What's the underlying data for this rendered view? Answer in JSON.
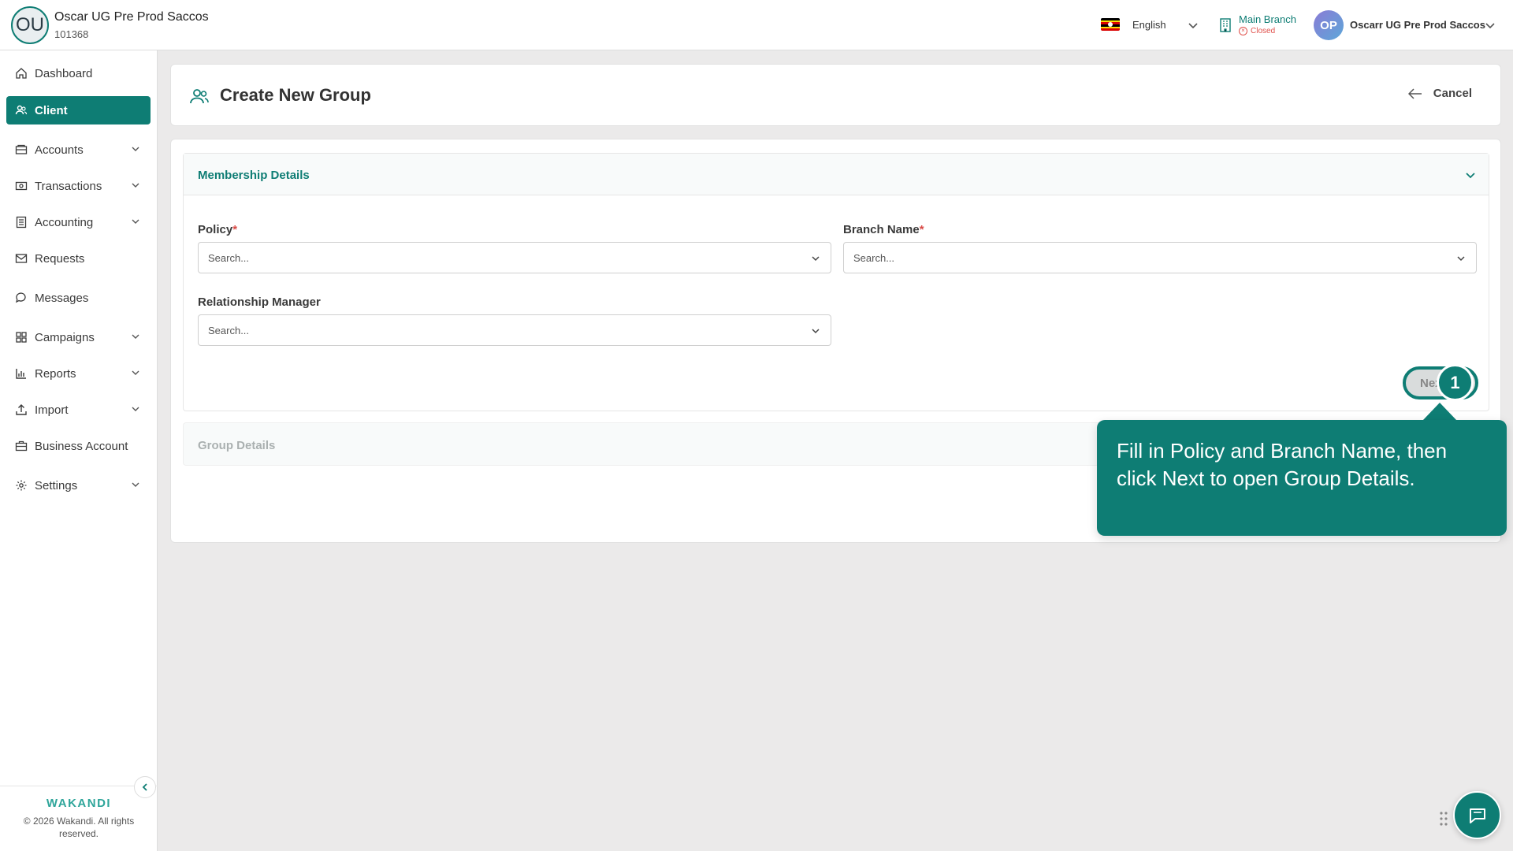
{
  "org": {
    "initials": "OU",
    "name": "Oscar UG Pre Prod Saccos",
    "id": "101368"
  },
  "header": {
    "language": "English",
    "branch_name": "Main Branch",
    "branch_status": "Closed",
    "user_initials": "OP",
    "user_name": "Oscarr UG Pre Prod Saccos"
  },
  "sidebar": {
    "items": [
      {
        "label": "Dashboard",
        "icon": "home-icon",
        "has_submenu": false
      },
      {
        "label": "Client",
        "icon": "users-icon",
        "has_submenu": false,
        "active": true
      },
      {
        "label": "Accounts",
        "icon": "wallet-icon",
        "has_submenu": true
      },
      {
        "label": "Transactions",
        "icon": "money-icon",
        "has_submenu": true
      },
      {
        "label": "Accounting",
        "icon": "ledger-icon",
        "has_submenu": true
      },
      {
        "label": "Requests",
        "icon": "mail-icon",
        "has_submenu": false
      },
      {
        "label": "Messages",
        "icon": "chat-icon",
        "has_submenu": false
      },
      {
        "label": "Campaigns",
        "icon": "grid-icon",
        "has_submenu": true
      },
      {
        "label": "Reports",
        "icon": "bar-chart-icon",
        "has_submenu": true
      },
      {
        "label": "Import",
        "icon": "upload-icon",
        "has_submenu": true
      },
      {
        "label": "Business Account",
        "icon": "briefcase-icon",
        "has_submenu": false
      },
      {
        "label": "Settings",
        "icon": "gear-icon",
        "has_submenu": true
      }
    ],
    "brand": "WAKANDI",
    "copyright": "© 2026 Wakandi. All rights reserved."
  },
  "page": {
    "title": "Create New Group",
    "cancel_label": "Cancel"
  },
  "form": {
    "section1_title": "Membership Details",
    "policy_label": "Policy",
    "policy_placeholder": "Search...",
    "branch_label": "Branch Name",
    "branch_placeholder": "Search...",
    "rm_label": "Relationship Manager",
    "rm_placeholder": "Search...",
    "required_mark": "*",
    "next_label": "Next",
    "section2_title": "Group Details"
  },
  "tour": {
    "step": "1",
    "text": "Fill in Policy and Branch Name, then click Next to open Group Details."
  },
  "colors": {
    "accent": "#0e7d74",
    "required": "#d94a46",
    "status_closed": "#e0524d"
  }
}
